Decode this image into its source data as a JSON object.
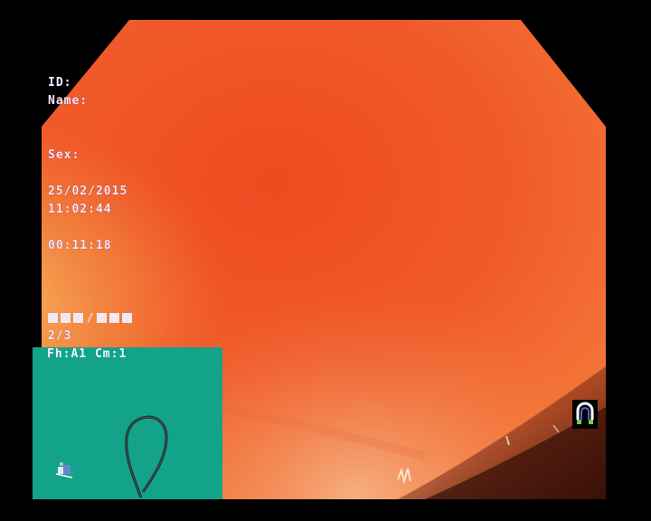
{
  "patient": {
    "id_label": "ID:",
    "name_label": "Name:",
    "sex_label": "Sex:"
  },
  "session": {
    "date": "25/02/2015",
    "time": "11:02:44",
    "elapsed": "00:11:18",
    "status_slash": "/",
    "fraction": "2/3"
  },
  "scope_panel": {
    "header": "Fh:A1 Cm:1",
    "background_color": "#13a389"
  },
  "colors": {
    "tissue_base": "#ee4f24",
    "tissue_light": "#f6a14a",
    "overlay_text": "#f3e6ff"
  },
  "icons": {
    "magnet": "magnet-icon",
    "scope_position": "patient-position-icon"
  }
}
